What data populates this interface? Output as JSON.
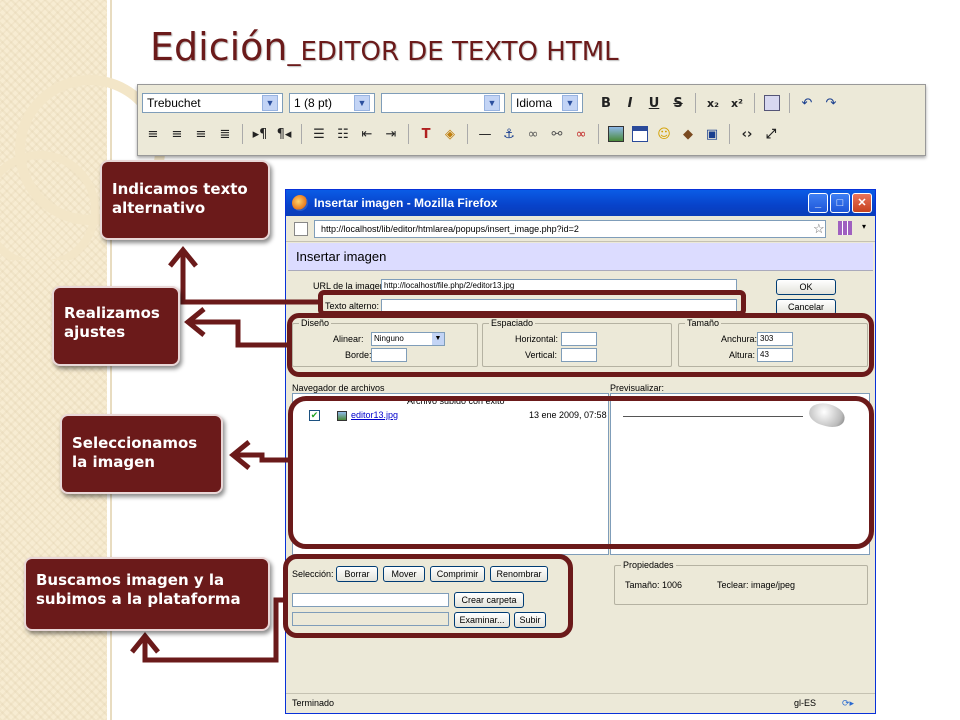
{
  "title": {
    "main": "Edición",
    "sub": "_EDITOR DE TEXTO HTML"
  },
  "toolbar": {
    "font_family": "Trebuchet",
    "font_size": "1 (8 pt)",
    "format_block": "",
    "language": "Idioma",
    "format_buttons": [
      "B",
      "I",
      "U",
      "S"
    ]
  },
  "callouts": [
    "Indicamos texto alternativo",
    "Realizamos ajustes",
    "Seleccionamos la imagen",
    "Buscamos imagen y la subimos a la plataforma"
  ],
  "window": {
    "title": "Insertar imagen - Mozilla Firefox",
    "url": "http://localhost/lib/editor/htmlarea/popups/insert_image.php?id=2",
    "page_header": "Insertar imagen",
    "image_url_label": "URL de la imagen:",
    "image_url_value": "http://localhost/file.php/2/editor13.jpg",
    "alt_label": "Texto alterno:",
    "ok_button": "OK",
    "cancel_button": "Cancelar",
    "diseno": {
      "legend": "Diseño",
      "alinear_label": "Alinear:",
      "alinear_value": "Ninguno",
      "borde_label": "Borde:"
    },
    "espaciado": {
      "legend": "Espaciado",
      "horizontal_label": "Horizontal:",
      "vertical_label": "Vertical:"
    },
    "tamano": {
      "legend": "Tamaño",
      "anchura_label": "Anchura:",
      "anchura_value": "303",
      "altura_label": "Altura:",
      "altura_value": "43"
    },
    "file_browser_label": "Navegador de archivos",
    "preview_label": "Previsualizar:",
    "upload_message": "Archivo subido con éxito",
    "file": {
      "name": "editor13.jpg",
      "date": "13 ene 2009, 07:58"
    },
    "seleccion_label": "Selección:",
    "action_buttons": [
      "Borrar",
      "Mover",
      "Comprimir",
      "Renombrar"
    ],
    "crear_carpeta_button": "Crear carpeta",
    "examinar_button": "Examinar...",
    "subir_button": "Subir",
    "propiedades": {
      "legend": "Propiedades",
      "tamano": "Tamaño: 1006",
      "teclear": "Teclear: image/jpeg"
    },
    "status": "Terminado",
    "locale": "gl-ES"
  },
  "colors": {
    "accent": "#6b1a1a",
    "xp_blue": "#0a5ce6"
  }
}
